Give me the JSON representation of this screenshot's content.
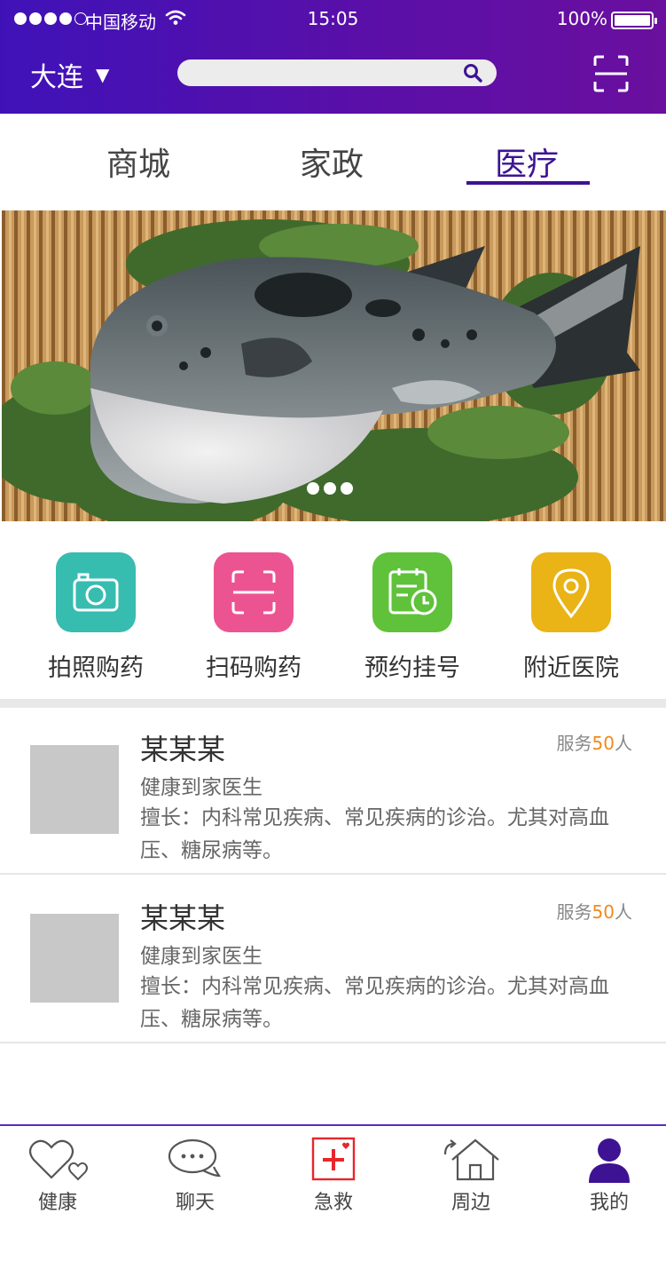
{
  "status_bar": {
    "carrier": "中国移动",
    "time": "15:05",
    "battery": "100%"
  },
  "header": {
    "city": "大连",
    "caret": "▼",
    "search_placeholder": ""
  },
  "tabs": [
    {
      "label": "商城"
    },
    {
      "label": "家政"
    },
    {
      "label": "医疗",
      "active": true
    }
  ],
  "banner": {
    "page_count": 3,
    "current_page": 1
  },
  "shortcuts": [
    {
      "label": "拍照购药",
      "icon": "camera-icon",
      "color": "#37bcb0"
    },
    {
      "label": "扫码购药",
      "icon": "scan-icon",
      "color": "#ec5491"
    },
    {
      "label": "预约挂号",
      "icon": "appointment-icon",
      "color": "#5fc23a"
    },
    {
      "label": "附近医院",
      "icon": "location-pin-icon",
      "color": "#eab316"
    }
  ],
  "doctors": [
    {
      "name": "某某某",
      "title": "健康到家医生",
      "served_prefix": "服务",
      "served_count": "50",
      "served_suffix": "人",
      "desc": "擅长：内科常见疾病、常见疾病的诊治。尤其对高血压、糖尿病等。"
    },
    {
      "name": "某某某",
      "title": "健康到家医生",
      "served_prefix": "服务",
      "served_count": "50",
      "served_suffix": "人",
      "desc": "擅长：内科常见疾病、常见疾病的诊治。尤其对高血压、糖尿病等。"
    }
  ],
  "bottom_nav": [
    {
      "label": "健康",
      "icon": "hearts-icon"
    },
    {
      "label": "聊天",
      "icon": "chat-bubble-icon"
    },
    {
      "label": "急救",
      "icon": "first-aid-icon"
    },
    {
      "label": "周边",
      "icon": "home-icon"
    },
    {
      "label": "我的",
      "icon": "user-icon",
      "active": true
    }
  ],
  "colors": {
    "brand": "#3d1394",
    "accent_orange": "#f08a1c",
    "first_aid_red": "#e8262c"
  }
}
